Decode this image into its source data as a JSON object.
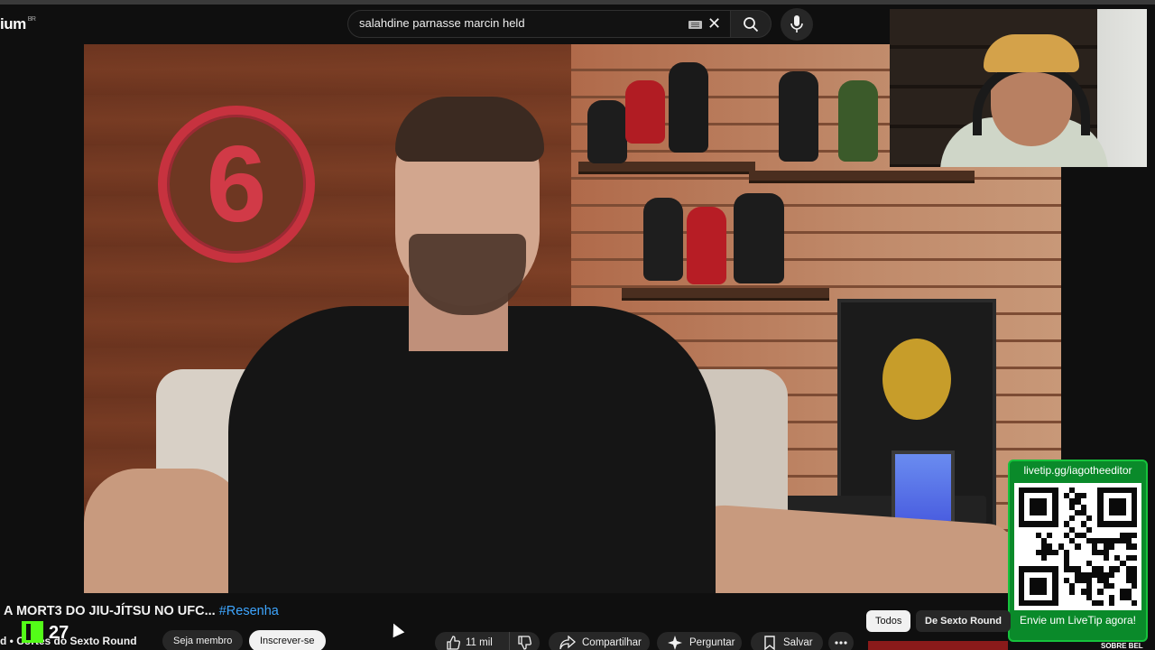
{
  "header": {
    "logo_text": "ium",
    "logo_region": "BR",
    "search_value": "salahdine parnasse marcin held"
  },
  "overlay": {
    "qr_url": "livetip.gg/iagotheeditor",
    "qr_cta": "Envie um LiveTip agora!",
    "kick_count": "27"
  },
  "video": {
    "title_main": "A MORT3 DO JIU-JÍTSU NO UFC...",
    "title_tag": "#Resenha",
    "channel": "d • Cortes do Sexto Round",
    "member_label": "Seja membro",
    "subscribe_label": "Inscrever-se"
  },
  "actions": {
    "likes": "11 mil",
    "share": "Compartilhar",
    "ask": "Perguntar",
    "save": "Salvar"
  },
  "chips": {
    "all": "Todos",
    "from_channel": "De Sexto Round"
  },
  "sidebar_preview": {
    "text": "SOBRE BEL"
  },
  "colors": {
    "background": "#0f0f0f",
    "link": "#3ea6ff",
    "livetip_green": "#0a8a2a",
    "kick_green": "#53fc18"
  }
}
